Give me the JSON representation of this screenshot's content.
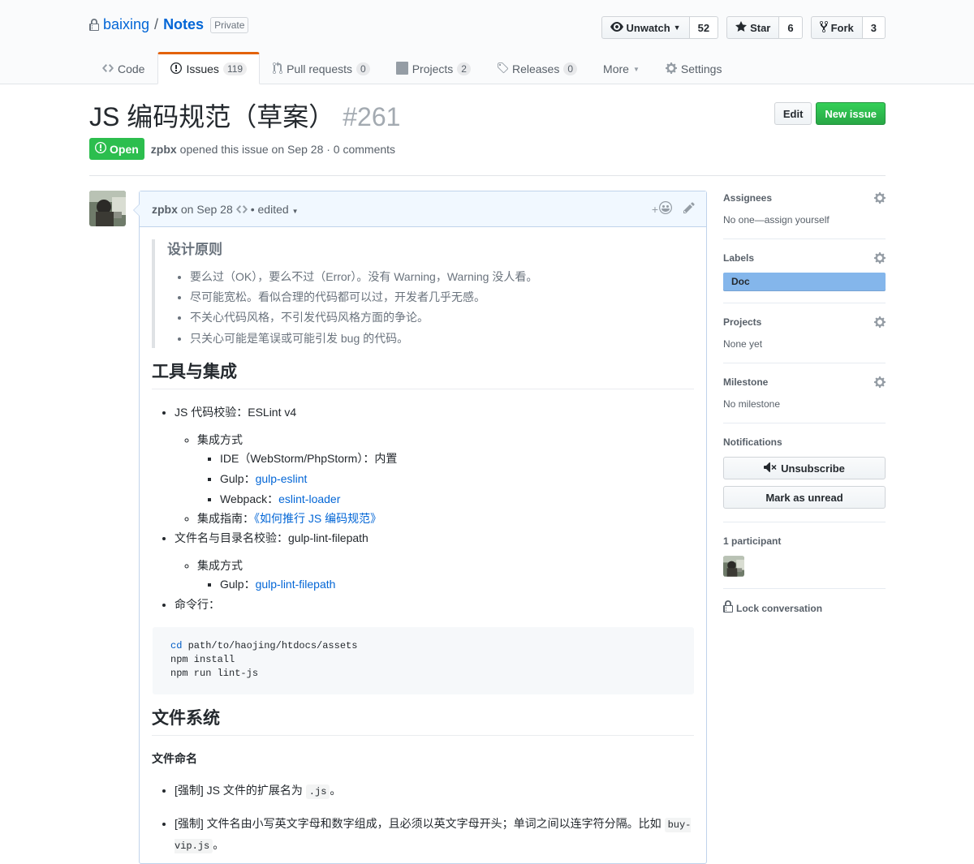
{
  "repo": {
    "owner": "baixing",
    "separator": "/",
    "name": "Notes",
    "visibility": "Private"
  },
  "actions": {
    "watch_label": "Unwatch",
    "watch_count": "52",
    "star_label": "Star",
    "star_count": "6",
    "fork_label": "Fork",
    "fork_count": "3"
  },
  "nav": {
    "code": "Code",
    "issues": "Issues",
    "issues_count": "119",
    "pulls": "Pull requests",
    "pulls_count": "0",
    "projects": "Projects",
    "projects_count": "2",
    "releases": "Releases",
    "releases_count": "0",
    "more": "More",
    "settings": "Settings"
  },
  "issue": {
    "title": "JS 编码规范（草案）",
    "number": "#261",
    "edit_label": "Edit",
    "new_issue_label": "New issue",
    "state": "Open",
    "author": "zpbx",
    "meta": "opened this issue on Sep 28 · 0 comments"
  },
  "comment": {
    "author": "zpbx",
    "date": "on Sep 28",
    "edited": "• edited",
    "add_reaction": "+",
    "principles_heading": "设计原则",
    "principles": [
      "要么过（OK），要么不过（Error）。没有 Warning，Warning 没人看。",
      "尽可能宽松。看似合理的代码都可以过，开发者几乎无感。",
      "不关心代码风格，不引发代码风格方面的争论。",
      "只关心可能是笔误或可能引发 bug 的代码。"
    ],
    "tools_heading": "工具与集成",
    "eslint_item": "JS 代码校验：ESLint v4",
    "integration_label": "集成方式",
    "ide_item": "IDE（WebStorm/PhpStorm）：内置",
    "gulp_prefix": "Gulp：",
    "gulp_link": "gulp-eslint",
    "webpack_prefix": "Webpack：",
    "webpack_link": "eslint-loader",
    "guide_prefix": "集成指南：",
    "guide_link": "《如何推行 JS 编码规范》",
    "filepath_item": "文件名与目录名校验：gulp-lint-filepath",
    "integration_label_2": "集成方式",
    "gulp2_prefix": "Gulp：",
    "gulp2_link": "gulp-lint-filepath",
    "cli_item": "命令行：",
    "code_cmd": "cd",
    "code_line1_rest": " path/to/haojing/htdocs/assets",
    "code_line2": "npm install",
    "code_line3": "npm run lint-js",
    "fs_heading": "文件系统",
    "naming_heading": "文件命名",
    "rule1_text": "[强制] JS 文件的扩展名为 ",
    "rule1_code": ".js",
    "rule1_end": "。",
    "rule2_text": "[强制] 文件名由小写英文字母和数字组成，且必须以英文字母开头；单词之间以连字符分隔。比如 ",
    "rule2_code": "buy-vip.js",
    "rule2_end": "。"
  },
  "sidebar": {
    "assignees_heading": "Assignees",
    "assignees_value": "No one—assign yourself",
    "labels_heading": "Labels",
    "label_doc": "Doc",
    "projects_heading": "Projects",
    "projects_value": "None yet",
    "milestone_heading": "Milestone",
    "milestone_value": "No milestone",
    "notifications_heading": "Notifications",
    "unsubscribe_label": "Unsubscribe",
    "mark_unread_label": "Mark as unread",
    "participants_heading": "1 participant",
    "lock_label": "Lock conversation"
  },
  "colors": {
    "accent": "#0366d6",
    "open_state": "#2cbe4e",
    "new_issue": "#28a745",
    "label_doc": "#84b6eb",
    "selected_tab_border": "#e36209"
  }
}
